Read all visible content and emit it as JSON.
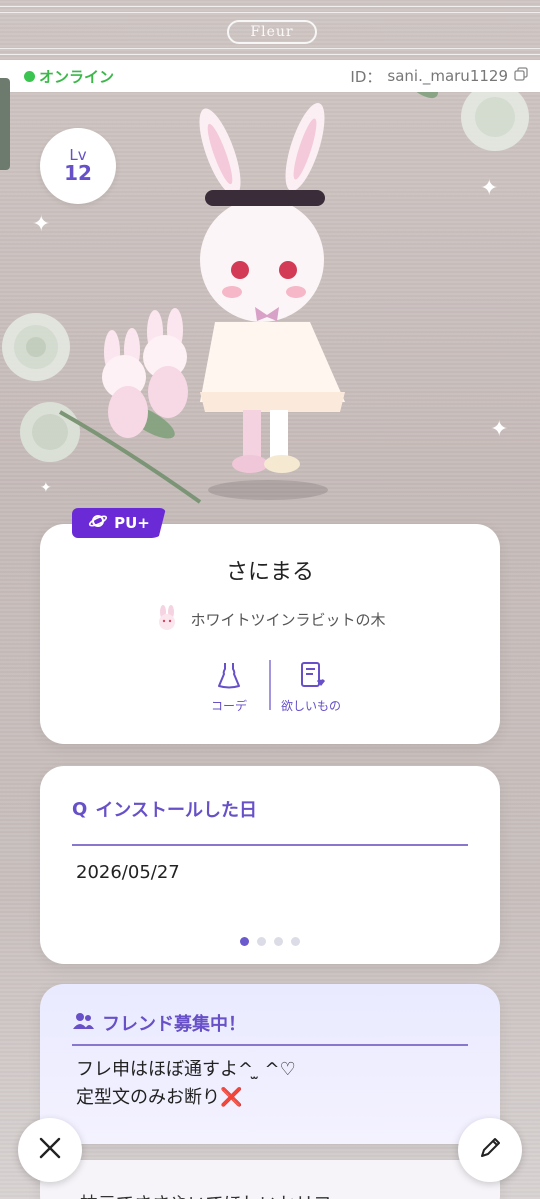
{
  "brand": {
    "name": "Fleur"
  },
  "status": {
    "online_label": "オンライン",
    "id_label": "ID：",
    "id_value": "sani._maru1129"
  },
  "level": {
    "label": "Lv",
    "value": "12"
  },
  "profile": {
    "badge": "PU+",
    "name": "さにまる",
    "title": "ホワイトツインラビットの木",
    "actions": [
      {
        "label": "コーデ",
        "icon": "dress-icon"
      },
      {
        "label": "欲しいもの",
        "icon": "wishlist-icon"
      }
    ]
  },
  "question_card": {
    "heading_prefix": "Q",
    "heading": "インストールした日",
    "answer": "2026/05/27",
    "page_count": 4,
    "active_page": 1
  },
  "friend_card": {
    "heading": "フレンド募集中！",
    "line1": "フレ申はほぼ通すよ^ ̫ ^♡",
    "line2": "定型文のみお断り❌"
  },
  "next_card": {
    "text": "枕元でささやいてほしいセリフ"
  },
  "colors": {
    "accent": "#6750c8",
    "online": "#3cc450",
    "badge": "#6a2bd6"
  }
}
